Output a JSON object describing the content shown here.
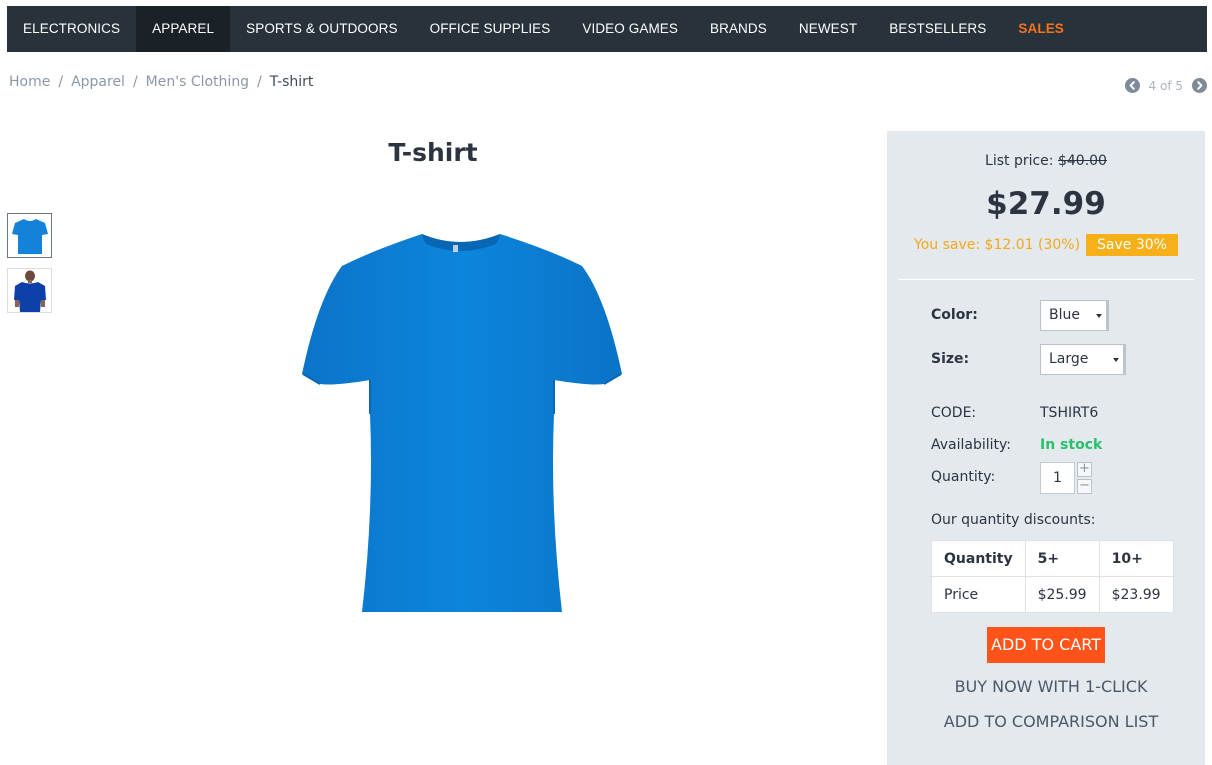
{
  "nav": {
    "items": [
      {
        "label": "ELECTRONICS"
      },
      {
        "label": "APPAREL"
      },
      {
        "label": "SPORTS & OUTDOORS"
      },
      {
        "label": "OFFICE SUPPLIES"
      },
      {
        "label": "VIDEO GAMES"
      },
      {
        "label": "BRANDS"
      },
      {
        "label": "NEWEST"
      },
      {
        "label": "BESTSELLERS"
      },
      {
        "label": "SALES"
      }
    ],
    "active_index": 1,
    "sales_color": "#f5731e"
  },
  "breadcrumb": {
    "items": [
      "Home",
      "Apparel",
      "Men's Clothing"
    ],
    "current": "T-shirt",
    "separator": "/"
  },
  "pager": {
    "text": "4 of 5",
    "prev_icon": "chevron-left-icon",
    "next_icon": "chevron-right-icon"
  },
  "product": {
    "title": "T-shirt",
    "image_color": "#0a7fd6",
    "thumbnails": [
      {
        "name": "tshirt-front-thumbnail",
        "color": "#1382d8"
      },
      {
        "name": "tshirt-model-thumbnail",
        "color": "#0d3fa8"
      }
    ]
  },
  "pricing": {
    "list_price_label": "List price:",
    "list_price_value": "$40.00",
    "price": "$27.99",
    "you_save": "You save: $12.01 (30%)",
    "save_badge": "Save 30%",
    "save_color": "#f3a71a"
  },
  "options": {
    "color_label": "Color:",
    "color_value": "Blue",
    "size_label": "Size:",
    "size_value": "Large"
  },
  "details": {
    "code_label": "CODE:",
    "code_value": "TSHIRT6",
    "availability_label": "Availability:",
    "availability_value": "In stock",
    "availability_color": "#28c06a",
    "quantity_label": "Quantity:",
    "quantity_value": "1",
    "qty_plus": "+",
    "qty_minus": "−"
  },
  "discounts": {
    "title": "Our quantity discounts:",
    "header": [
      "Quantity",
      "5+",
      "10+"
    ],
    "row": [
      "Price",
      "$25.99",
      "$23.99"
    ]
  },
  "actions": {
    "add_to_cart": "ADD TO CART",
    "buy_now": "BUY NOW WITH 1-CLICK",
    "compare": "ADD TO COMPARISON LIST",
    "cart_color": "#ff5319"
  }
}
